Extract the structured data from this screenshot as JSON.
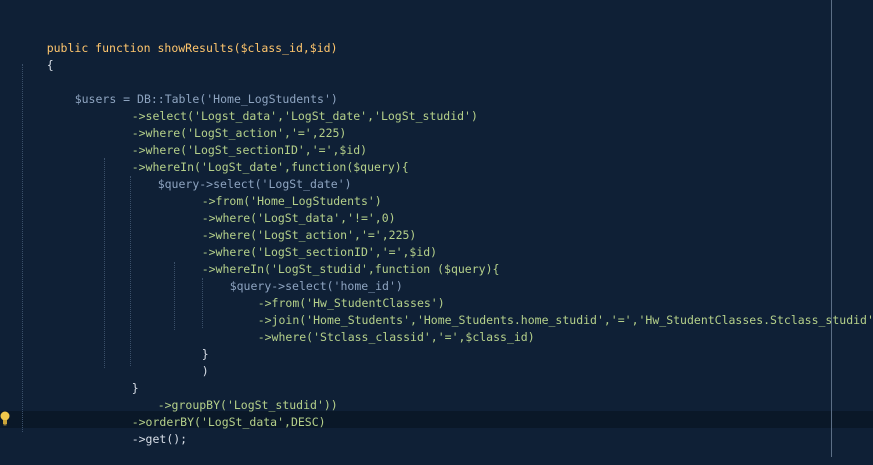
{
  "lines": [
    [
      "public function showResults($class_id,$id)"
    ],
    [
      "{"
    ],
    [
      ""
    ],
    [
      "$users = DB::Table('Home_LogStudents')"
    ],
    [
      "->select('Logst_data','LogSt_date','LogSt_studid')"
    ],
    [
      "->where('LogSt_action','=',225)"
    ],
    [
      "->where('LogSt_sectionID','=',$id)"
    ],
    [
      "->whereIn('LogSt_date',function($query){"
    ],
    [
      "$query->select('LogSt_date')"
    ],
    [
      "->from('Home_LogStudents')"
    ],
    [
      "->where('LogSt_data','!=',0)"
    ],
    [
      "->where('LogSt_action','=',225)"
    ],
    [
      "->where('LogSt_sectionID','=',$id)"
    ],
    [
      "->whereIn('LogSt_studid',function ($query){"
    ],
    [
      "$query->select('home_id')"
    ],
    [
      "->from('Hw_StudentClasses')"
    ],
    [
      "->join('Home_Students','Home_Students.home_studid','=','Hw_StudentClasses.Stclass_studid')"
    ],
    [
      "->where('Stclass_classid','=',$class_id)"
    ],
    [
      "}"
    ],
    [
      ")"
    ],
    [
      "}"
    ],
    [
      "->groupBY('LogSt_studid'))"
    ],
    [
      "->orderBY('LogSt_data',DESC)"
    ],
    [
      "->get();"
    ]
  ],
  "colors": {
    "background": "#0f2036",
    "keyword": "#ffc66d",
    "string": "#b5d08a",
    "number": "#f09a5c",
    "variable": "#8ea4c0"
  },
  "icons": {
    "intention_bulb": "lightbulb-icon"
  }
}
